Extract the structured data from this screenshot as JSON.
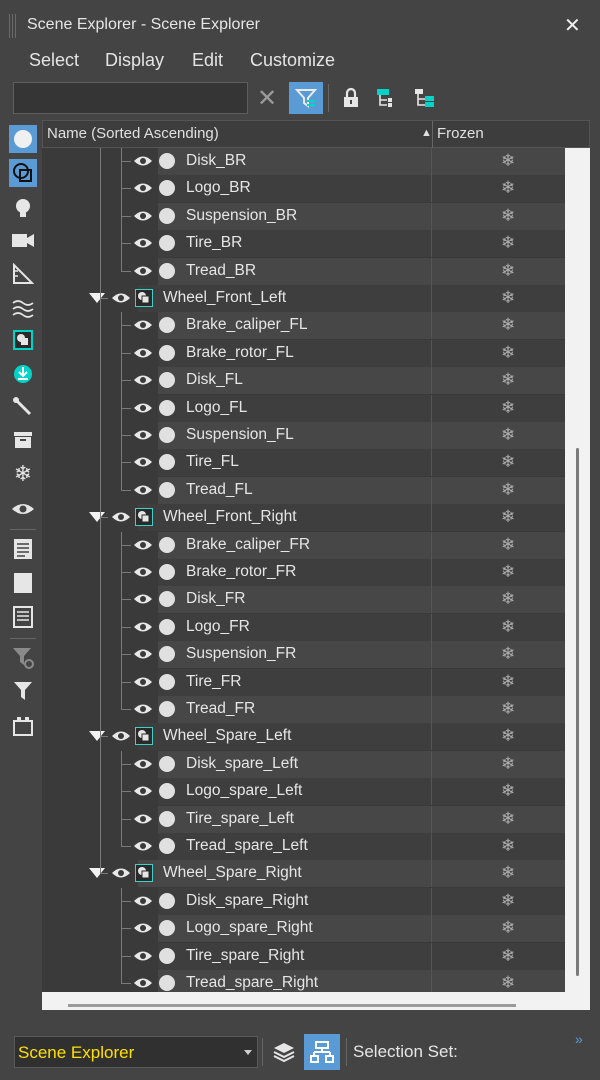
{
  "window": {
    "title": "Scene Explorer - Scene Explorer",
    "close_glyph": "✕"
  },
  "menu": [
    "Select",
    "Display",
    "Edit",
    "Customize"
  ],
  "toolbar": {
    "search_value": "",
    "clear_icon": "close-icon",
    "filter_icon": "filter-icon",
    "lock_icon": "lock-icon",
    "hierarchy_icon_1": "hierarchy-icon",
    "hierarchy_icon_2": "hierarchy-select-icon"
  },
  "left_tools": [
    "display-geometry-icon",
    "display-shapes-icon",
    "display-lights-icon",
    "display-cameras-icon",
    "display-helpers-icon",
    "display-spacewarps-icon",
    "display-groups-icon",
    "display-xrefs-icon",
    "display-bones-icon",
    "display-containers-icon",
    "display-frozen-icon",
    "display-hidden-icon",
    "display-all-icon",
    "display-none-icon",
    "invert-display-icon",
    "filter-options-icon",
    "filter-icon",
    "toggle-children-icon"
  ],
  "header": {
    "name": "Name (Sorted Ascending)",
    "sort_arrow": "▲",
    "frozen": "Frozen"
  },
  "rows": [
    {
      "label": "Disk_BR",
      "level": 2
    },
    {
      "label": "Logo_BR",
      "level": 2
    },
    {
      "label": "Suspension_BR",
      "level": 2
    },
    {
      "label": "Tire_BR",
      "level": 2
    },
    {
      "label": "Tread_BR",
      "level": 2
    },
    {
      "label": "Wheel_Front_Left",
      "level": 1,
      "group": true
    },
    {
      "label": "Brake_caliper_FL",
      "level": 2
    },
    {
      "label": "Brake_rotor_FL",
      "level": 2
    },
    {
      "label": "Disk_FL",
      "level": 2
    },
    {
      "label": "Logo_FL",
      "level": 2
    },
    {
      "label": "Suspension_FL",
      "level": 2
    },
    {
      "label": "Tire_FL",
      "level": 2
    },
    {
      "label": "Tread_FL",
      "level": 2
    },
    {
      "label": "Wheel_Front_Right",
      "level": 1,
      "group": true
    },
    {
      "label": "Brake_caliper_FR",
      "level": 2
    },
    {
      "label": "Brake_rotor_FR",
      "level": 2
    },
    {
      "label": "Disk_FR",
      "level": 2
    },
    {
      "label": "Logo_FR",
      "level": 2
    },
    {
      "label": "Suspension_FR",
      "level": 2
    },
    {
      "label": "Tire_FR",
      "level": 2
    },
    {
      "label": "Tread_FR",
      "level": 2
    },
    {
      "label": "Wheel_Spare_Left",
      "level": 1,
      "group": true
    },
    {
      "label": "Disk_spare_Left",
      "level": 2
    },
    {
      "label": "Logo_spare_Left",
      "level": 2
    },
    {
      "label": "Tire_spare_Left",
      "level": 2
    },
    {
      "label": "Tread_spare_Left",
      "level": 2
    },
    {
      "label": "Wheel_Spare_Right",
      "level": 1,
      "group": true
    },
    {
      "label": "Disk_spare_Right",
      "level": 2
    },
    {
      "label": "Logo_spare_Right",
      "level": 2
    },
    {
      "label": "Tire_spare_Right",
      "level": 2
    },
    {
      "label": "Tread_spare_Right",
      "level": 2
    }
  ],
  "frozen_glyph": "❄",
  "bottom": {
    "explorer_name": "Scene Explorer",
    "selection_set_label": "Selection Set:",
    "expand_glyph": "»"
  },
  "colors": {
    "accent": "#5b9bd5",
    "group_icon": "#3fd0c8",
    "explorer_name": "#ffe000",
    "panel": "#444444"
  }
}
